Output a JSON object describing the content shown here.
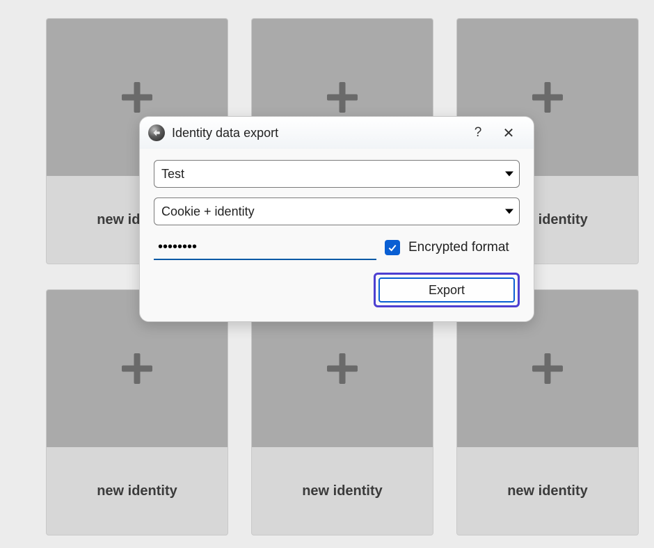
{
  "grid": {
    "card_label": "new identity",
    "count": 6
  },
  "dialog": {
    "title": "Identity data export",
    "help_label": "?",
    "close_label": "✕",
    "identity_select": {
      "value": "Test"
    },
    "type_select": {
      "value": "Cookie + identity"
    },
    "password": {
      "value": "••••••••"
    },
    "encrypted": {
      "checked": true,
      "label": "Encrypted format"
    },
    "export_button": "Export"
  },
  "colors": {
    "accent": "#0a5fd3",
    "highlight": "#4d3fd1"
  }
}
